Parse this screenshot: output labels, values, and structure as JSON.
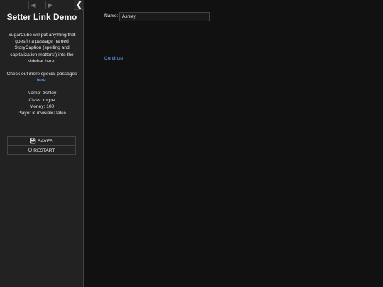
{
  "sidebar": {
    "nav_back_icon": "arrow-left-icon",
    "nav_forward_icon": "arrow-right-icon",
    "stow_icon": "chevron-left-icon",
    "title": "Setter Link Demo",
    "caption_text": "SugarCube will put anything that goes in a passage named StoryCaption (spelling and capitalization matters!) into the sidebar here!",
    "special_prefix": "Check out more special passages ",
    "special_link": "here",
    "special_suffix": ".",
    "stats": [
      "Name: Ashley",
      "Class: rogue",
      "Money: 100",
      "Player is invisible: false"
    ],
    "menu": {
      "saves_label": "SAVES",
      "saves_icon": "floppy-disk-icon",
      "restart_label": "RESTART",
      "restart_icon": "power-icon"
    }
  },
  "passage": {
    "name_label": "Name:",
    "name_value": "Ashley",
    "continue_label": "Continue"
  },
  "colors": {
    "sidebar_bg": "#222222",
    "main_bg": "#111111",
    "link": "#68a0ff",
    "text": "#eeeeee",
    "border": "#444444"
  }
}
